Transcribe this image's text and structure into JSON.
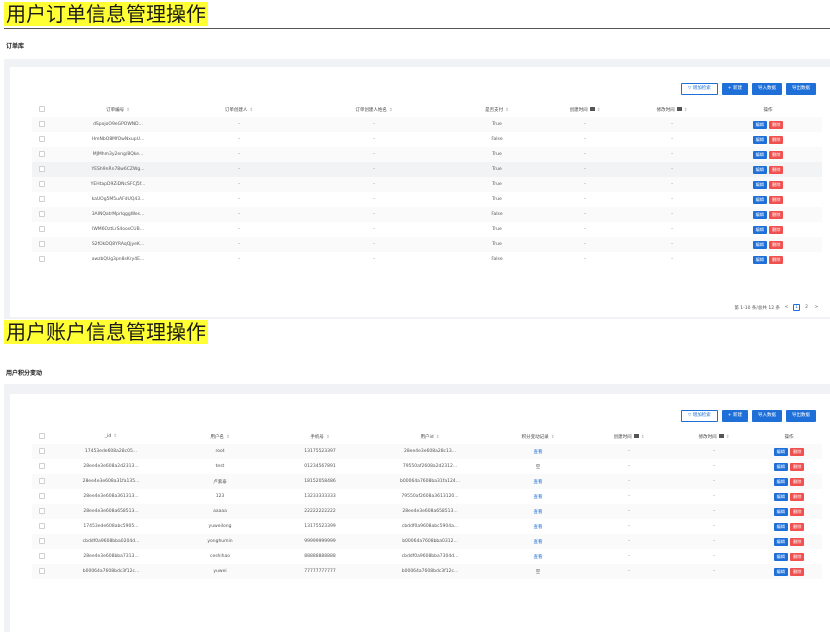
{
  "section1": {
    "heading": "用户订单信息管理操作",
    "title": "订单库",
    "toolbar": {
      "filter": "增加检索",
      "create": "新建",
      "import": "导入数据",
      "export": "导出数据"
    },
    "columns": [
      "订单编号",
      "订单创建人",
      "订单创建人姓名",
      "是否支付",
      "创建时间",
      "修改时间",
      "操作"
    ],
    "rows": [
      [
        "dSpojoO9eGPOWND...",
        "-",
        "-",
        "True",
        "-",
        "-"
      ],
      [
        "HmNbO8MfOwNxupU...",
        "-",
        "-",
        "False",
        "-",
        "-"
      ],
      [
        "MJMhm3y2eng/8Qke...",
        "-",
        "-",
        "True",
        "-",
        "-"
      ],
      [
        "YESh9nRn78w6CZWg...",
        "-",
        "-",
        "True",
        "-",
        "-"
      ],
      [
        "YEHtapD9ZiDNcSFCJ5f...",
        "-",
        "-",
        "True",
        "-",
        "-"
      ],
      [
        "kaUOg5M5uAFdUQ43...",
        "-",
        "-",
        "True",
        "-",
        "-"
      ],
      [
        "3AINQatrMprIqggWes...",
        "-",
        "-",
        "False",
        "-",
        "-"
      ],
      [
        "IWM6OztLrS4oosCUB...",
        "-",
        "-",
        "True",
        "-",
        "-"
      ],
      [
        "S2fOkDQ8YRAqQjyeK...",
        "-",
        "-",
        "True",
        "-",
        "-"
      ],
      [
        "awzbQUg3pn8sKry4E...",
        "-",
        "-",
        "False",
        "-",
        "-"
      ]
    ],
    "edit": "编辑",
    "delete": "删除",
    "pagination": {
      "summary": "第 1-10 条/总共 12 条",
      "prev": "<",
      "page1": "1",
      "page2": "2",
      "next": ">"
    }
  },
  "section2": {
    "heading": "用户账户信息管理操作",
    "title": "用户积分变动",
    "toolbar": {
      "filter": "增加检索",
      "create": "新建",
      "import": "导入数据",
      "export": "导出数据"
    },
    "columns": [
      "_id",
      "用户名",
      "手机号",
      "用户id",
      "积分变动记录",
      "创建时间",
      "修改时间",
      "操作"
    ],
    "rows": [
      [
        "17453ede608a28c05...",
        "root",
        "13175523397",
        "28ee4e3e608a28c13...",
        "查看",
        "-",
        "-"
      ],
      [
        "28ee4e3e608a2d2313...",
        "test",
        "01234567891",
        "79550af2608a2d2312...",
        "空",
        "-",
        "-"
      ],
      [
        "28ee4e3e608a31fa135...",
        "卢紫泰",
        "18152058486",
        "b00064a7608ba31fa124...",
        "查看",
        "-",
        "-"
      ],
      [
        "28ee4e3e608a361313...",
        "123",
        "13233333333",
        "79550af2608a3613120...",
        "查看",
        "-",
        "-"
      ],
      [
        "28ee4e3e608a658513...",
        "aaaaa",
        "22222222222",
        "28ee4e3e608a658513...",
        "查看",
        "-",
        "-"
      ],
      [
        "17453ede608abc5905...",
        "yuweilong",
        "13175523399",
        "cbddf0a9608abc5904a...",
        "查看",
        "-",
        "-"
      ],
      [
        "cbddf0a9608bba0204d...",
        "yonghumin",
        "99999999999",
        "b00064a7608bba0312...",
        "查看",
        "-",
        "-"
      ],
      [
        "28ee4e3e608bba7313...",
        "ceshihao",
        "88888888888",
        "cbddf0a9608bba7304d...",
        "查看",
        "-",
        "-"
      ],
      [
        "b00064a7608bdc3f12c...",
        "yuwei",
        "77777777777",
        "b00064a7608bdc3f12c...",
        "空",
        "-",
        "-"
      ]
    ],
    "edit": "编辑",
    "delete": "删除"
  },
  "colors": {
    "primary": "#1f6fd8",
    "danger": "#f0504f",
    "highlight": "#ffff33",
    "band": "#f0f2f5"
  },
  "icons": {
    "filter": "funnel-icon",
    "create": "plus-icon",
    "sort": "sort-caret-icon",
    "group": "group-icon"
  }
}
